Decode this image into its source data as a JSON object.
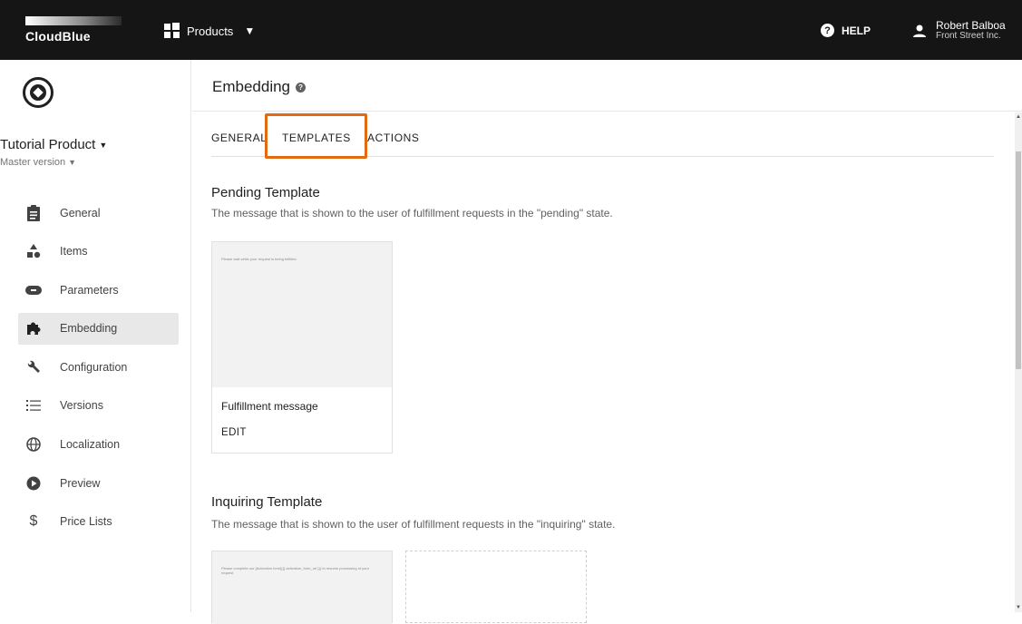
{
  "topbar": {
    "logo_text": "CloudBlue",
    "products_label": "Products",
    "help_label": "HELP",
    "user_name": "Robert Balboa",
    "user_company": "Front Street Inc."
  },
  "sidebar": {
    "product_name": "Tutorial Product",
    "product_version": "Master version",
    "items": [
      {
        "label": "General",
        "icon": "clipboard-icon"
      },
      {
        "label": "Items",
        "icon": "shapes-icon"
      },
      {
        "label": "Parameters",
        "icon": "pill-icon"
      },
      {
        "label": "Embedding",
        "icon": "puzzle-icon",
        "active": true
      },
      {
        "label": "Configuration",
        "icon": "wrench-icon"
      },
      {
        "label": "Versions",
        "icon": "list-numbered-icon"
      },
      {
        "label": "Localization",
        "icon": "globe-icon"
      },
      {
        "label": "Preview",
        "icon": "play-circle-icon"
      },
      {
        "label": "Price Lists",
        "icon": "dollar-icon"
      }
    ]
  },
  "main": {
    "title": "Embedding",
    "tabs": [
      {
        "label": "GENERAL"
      },
      {
        "label": "TEMPLATES",
        "selected": true
      },
      {
        "label": "ACTIONS"
      }
    ],
    "pending": {
      "title": "Pending Template",
      "description": "The message that is shown to the user of fulfillment requests in the \"pending\" state.",
      "card": {
        "preview_text": "Please wait while your request is being fulfilled.",
        "title": "Fulfillment message",
        "action": "EDIT"
      }
    },
    "inquiring": {
      "title": "Inquiring Template",
      "description": "The message that is shown to the user of fulfillment requests in the \"inquiring\" state.",
      "card": {
        "preview_text": "Please complete our [Activation form]({{ activation_form_url }}) to resume processing of your request"
      }
    }
  },
  "colors": {
    "topbar_bg": "#151515",
    "highlight": "#e16a12",
    "active_nav_bg": "#e8e8e8"
  }
}
